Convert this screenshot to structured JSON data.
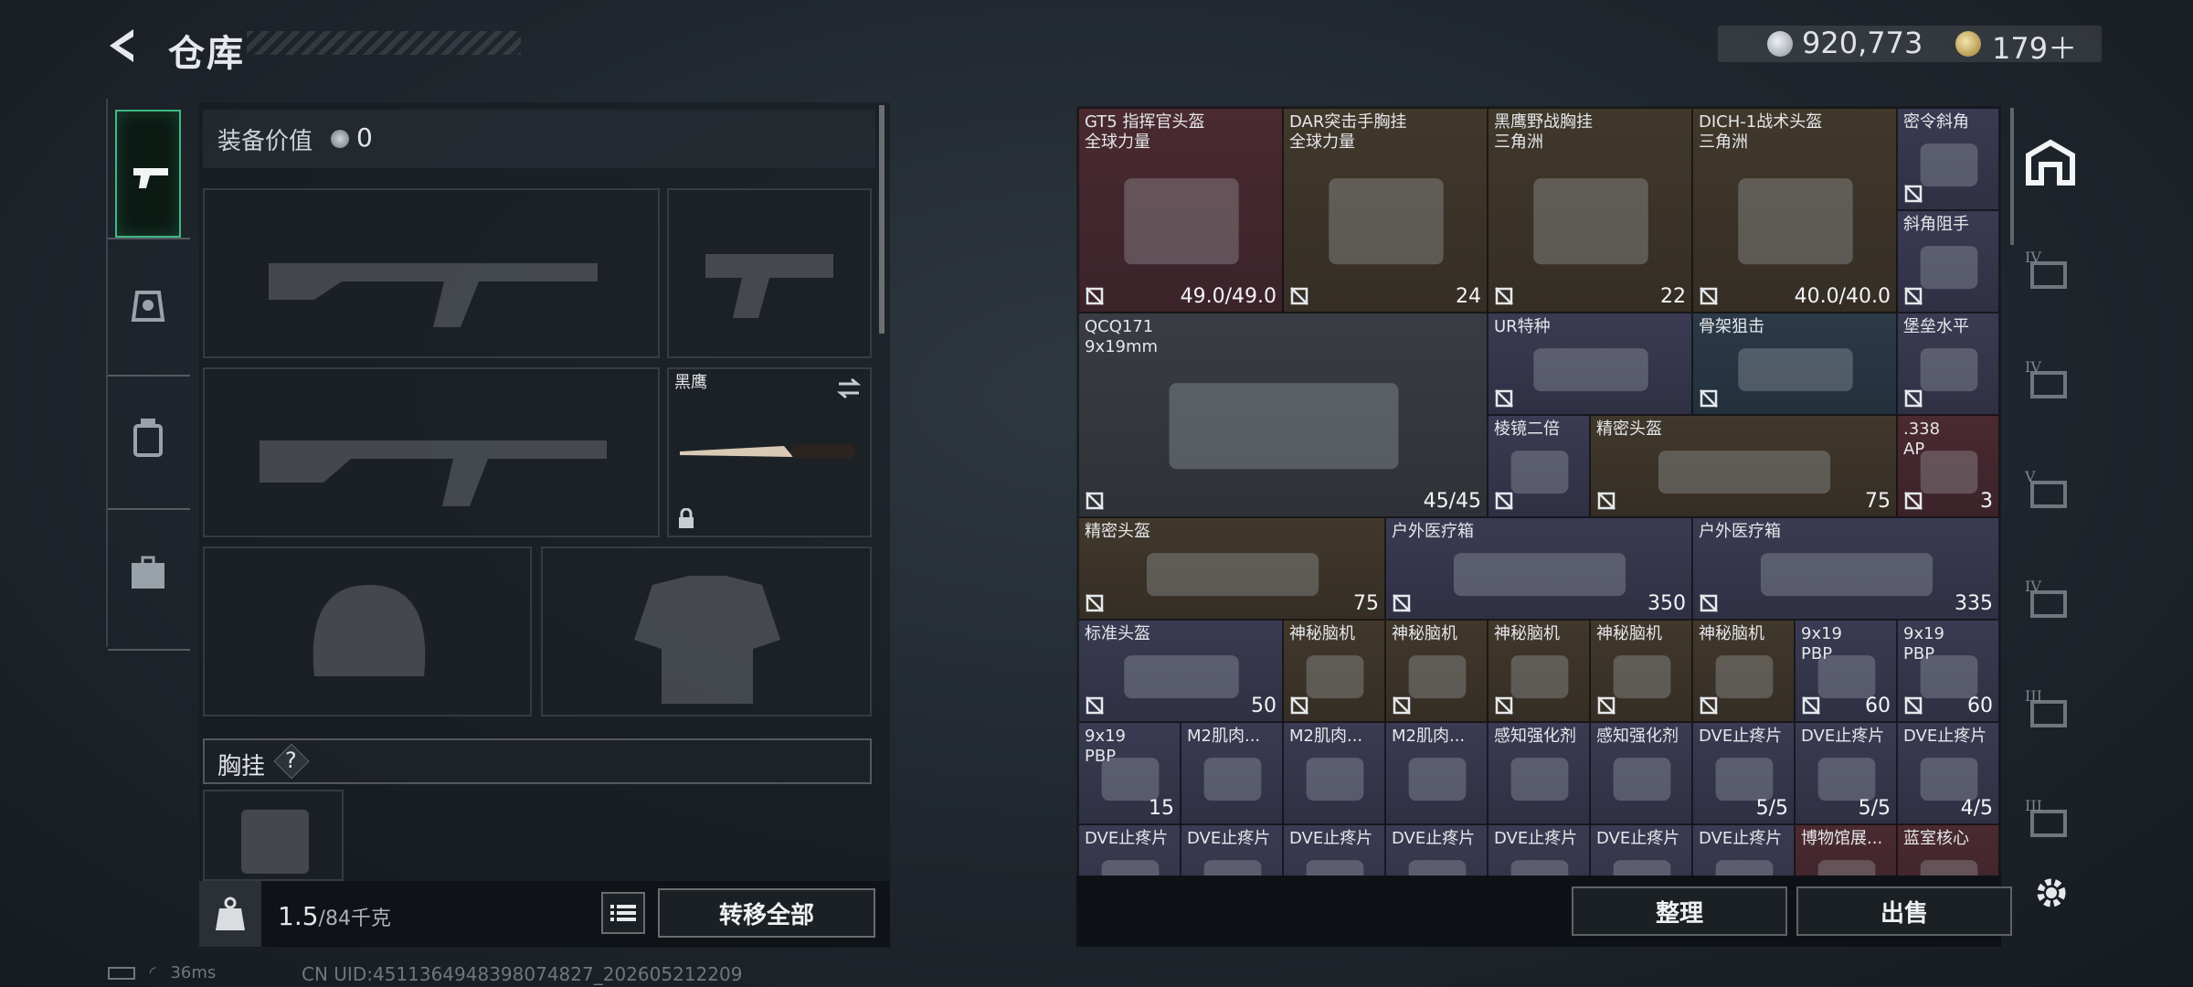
{
  "header": {
    "title": "仓库",
    "currency1": "920,773",
    "currency2": "179＋"
  },
  "nav": {
    "items": [
      "weapon",
      "armor",
      "backpack",
      "toolbox"
    ]
  },
  "loadout": {
    "equip_label": "装备价值",
    "equip_value": "0",
    "melee_name": "黑鹰",
    "chest_label": "胸挂",
    "chest_help": "?",
    "weight": "1.5",
    "weight_unit": "/84千克",
    "transfer_all": "转移全部"
  },
  "grid": {
    "items": [
      {
        "name": "GT5 指挥官头盔\n全球力量",
        "count": "49.0/49.0",
        "rarity": "red"
      },
      {
        "name": "DAR突击手胸挂\n全球力量",
        "count": "24",
        "rarity": "brown"
      },
      {
        "name": "黑鹰野战胸挂\n三角洲",
        "count": "22",
        "rarity": "brown"
      },
      {
        "name": "DICH-1战术头盔\n三角洲",
        "count": "40.0/40.0",
        "rarity": "brown"
      },
      {
        "name": "密令斜角",
        "count": "",
        "rarity": "purple"
      },
      {
        "name": "斜角阻手",
        "count": "",
        "rarity": "purple"
      },
      {
        "name": "QCQ171\n9x19mm",
        "count": "45/45",
        "rarity": "grey"
      },
      {
        "name": "UR特种",
        "count": "",
        "rarity": "purple"
      },
      {
        "name": "骨架狙击",
        "count": "",
        "rarity": "blue"
      },
      {
        "name": "堡垒水平",
        "count": "",
        "rarity": "purple"
      },
      {
        "name": "棱镜二倍",
        "count": "",
        "rarity": "purple"
      },
      {
        "name": "精密头盔",
        "count": "75",
        "rarity": "brown"
      },
      {
        "name": ".338\nAP",
        "count": "3",
        "rarity": "red"
      },
      {
        "name": "精密头盔",
        "count": "75",
        "rarity": "brown"
      },
      {
        "name": "户外医疗箱",
        "count": "350",
        "rarity": "purple"
      },
      {
        "name": "户外医疗箱",
        "count": "335",
        "rarity": "purple"
      },
      {
        "name": "标准头盔",
        "count": "50",
        "rarity": "purple"
      },
      {
        "name": "神秘脑机",
        "count": "",
        "rarity": "brown"
      },
      {
        "name": "神秘脑机",
        "count": "",
        "rarity": "brown"
      },
      {
        "name": "神秘脑机",
        "count": "",
        "rarity": "brown"
      },
      {
        "name": "神秘脑机",
        "count": "",
        "rarity": "brown"
      },
      {
        "name": "神秘脑机",
        "count": "",
        "rarity": "brown"
      },
      {
        "name": "9x19\nPBP",
        "count": "60",
        "rarity": "purple"
      },
      {
        "name": "9x19\nPBP",
        "count": "60",
        "rarity": "purple"
      },
      {
        "name": "9x19\nPBP",
        "count": "15",
        "rarity": "purple"
      },
      {
        "name": "M2肌肉...",
        "count": "",
        "rarity": "purple"
      },
      {
        "name": "M2肌肉...",
        "count": "",
        "rarity": "purple"
      },
      {
        "name": "M2肌肉...",
        "count": "",
        "rarity": "purple"
      },
      {
        "name": "感知强化剂",
        "count": "",
        "rarity": "purple"
      },
      {
        "name": "感知强化剂",
        "count": "",
        "rarity": "purple"
      },
      {
        "name": "DVE止疼片",
        "count": "5/5",
        "rarity": "purple"
      },
      {
        "name": "DVE止疼片",
        "count": "5/5",
        "rarity": "purple"
      },
      {
        "name": "DVE止疼片",
        "count": "4/5",
        "rarity": "purple"
      },
      {
        "name": "DVE止疼片",
        "count": "",
        "rarity": "purple"
      },
      {
        "name": "DVE止疼片",
        "count": "",
        "rarity": "purple"
      },
      {
        "name": "DVE止疼片",
        "count": "",
        "rarity": "purple"
      },
      {
        "name": "DVE止疼片",
        "count": "",
        "rarity": "purple"
      },
      {
        "name": "DVE止疼片",
        "count": "",
        "rarity": "purple"
      },
      {
        "name": "DVE止疼片",
        "count": "",
        "rarity": "purple"
      },
      {
        "name": "DVE止疼片",
        "count": "",
        "rarity": "purple"
      },
      {
        "name": "博物馆展...",
        "count": "",
        "rarity": "red"
      },
      {
        "name": "蓝室核心",
        "count": "",
        "rarity": "red"
      }
    ],
    "sort": "整理",
    "sell": "出售"
  },
  "side_tabs": [
    "IV",
    "IV",
    "V",
    "IV",
    "III",
    "III"
  ],
  "status": {
    "latency": "36ms",
    "uid": "CN UID:4511364948398074827_202605212209"
  },
  "colors": {
    "red": "#4a2a30",
    "brown": "#41382c",
    "purple": "#3a3b52",
    "blue": "#2c3a48",
    "accent": "#3fb784"
  }
}
